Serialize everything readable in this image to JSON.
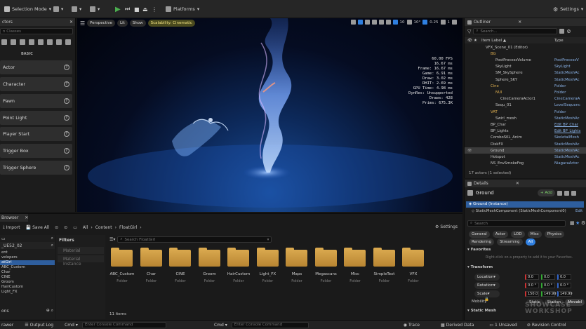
{
  "toolbar": {
    "mode": "Selection Mode",
    "platforms": "Platforms",
    "settings": "Settings"
  },
  "left_panel": {
    "tab": "ctors",
    "search_placeholder": "n Classes",
    "category": "BASIC",
    "items": [
      "Actor",
      "Character",
      "Pawn",
      "Point Light",
      "Player Start",
      "Trigger Box",
      "Trigger Sphere"
    ]
  },
  "viewport": {
    "perspective": "Perspective",
    "lit": "Lit",
    "show": "Show",
    "scalability": "Scalability: Cinematic",
    "grid": "10",
    "angle": "10°",
    "speed": "0.25",
    "cams": "1",
    "stats": {
      "fps": "60.00 FPS",
      "ms": "16.67 ms",
      "frame": "Frame:  16.67 ms",
      "game": "Game:  6.91 ms",
      "draw": "Draw:  3.02 ms",
      "rhit": "RHIT:  2.69 ms",
      "gpu": "GPU Time:  4.98 ms",
      "dynres": "DynRes:  Unsupported",
      "draws": "Draws:  428",
      "prims": "Prims:  675.3K"
    }
  },
  "outliner": {
    "tab": "Outliner",
    "search_placeholder": "Search...",
    "col_label": "Item Label ▲",
    "col_type": "Type",
    "rows": [
      {
        "name": "VFX_Scene_01 (Editor)",
        "type": "",
        "indent": 0
      },
      {
        "name": "BG",
        "type": "",
        "indent": 1,
        "folder": true
      },
      {
        "name": "PostProcessVolume",
        "type": "PostProcessV",
        "indent": 2
      },
      {
        "name": "SkyLight",
        "type": "SkyLight",
        "indent": 2
      },
      {
        "name": "SM_SkySphere",
        "type": "StaticMeshAc",
        "indent": 2
      },
      {
        "name": "Sphere_SKY",
        "type": "StaticMeshAc",
        "indent": 2
      },
      {
        "name": "Cine",
        "type": "Folder",
        "indent": 1,
        "folder": true
      },
      {
        "name": "NUI",
        "type": "Folder",
        "indent": 2,
        "folder": true
      },
      {
        "name": "CineCameraActor1",
        "type": "CineCameraA",
        "indent": 3
      },
      {
        "name": "Sequ_01",
        "type": "LevelSequenc",
        "indent": 2
      },
      {
        "name": "VAT",
        "type": "Folder",
        "indent": 1,
        "folder": true
      },
      {
        "name": "Swirl_mesh",
        "type": "StaticMeshAc",
        "indent": 2
      },
      {
        "name": "BP_Char",
        "type": "Edit BP_Char",
        "indent": 1
      },
      {
        "name": "BP_Lights",
        "type": "Edit BP_Lights",
        "indent": 1
      },
      {
        "name": "ComboSKL_Anim",
        "type": "SkeletalMesh",
        "indent": 1
      },
      {
        "name": "DiskFX",
        "type": "StaticMeshAc",
        "indent": 1
      },
      {
        "name": "Ground",
        "type": "StaticMeshAc",
        "indent": 1,
        "selected": true
      },
      {
        "name": "Hotspot",
        "type": "StaticMeshAc",
        "indent": 1
      },
      {
        "name": "NS_EnvSmokeFog",
        "type": "NiagaraActor",
        "indent": 1
      }
    ],
    "footer": "17 actors (1 selected)"
  },
  "details": {
    "tab": "Details",
    "object": "Ground",
    "add": "+ Add",
    "instance": "Ground (Instance)",
    "component": "StaticMeshComponent (StaticMeshComponent0)",
    "edit": "Edit",
    "search_placeholder": "Search",
    "filters_row1": [
      "General",
      "Actor",
      "LOD",
      "Misc",
      "Physics"
    ],
    "filters_row2": [
      "Rendering",
      "Streaming",
      "All"
    ],
    "favorites": "Favorites",
    "favorites_hint": "Right-click on a property to add it to your Favorites.",
    "transform": "Transform",
    "location": "Location",
    "rotation": "Rotation",
    "scale": "Scale",
    "mobility": "Mobility",
    "loc_vals": [
      "0.0",
      "0.0",
      "0.0"
    ],
    "rot_vals": [
      "0.0 °",
      "0.0 °",
      "0.0 °"
    ],
    "scale_vals": [
      "150.0",
      "149.99",
      "149.99"
    ],
    "mob_opts": [
      "Static",
      "Station",
      "Movabl"
    ],
    "static_mesh": "Static Mesh"
  },
  "browser": {
    "tab": "Browser",
    "import": "Import",
    "save_all": "Save All",
    "crumbs": [
      "All",
      "Content",
      "FloatGirl"
    ],
    "settings": "Settings",
    "search_placeholder": "Search FloatGirl",
    "filters": "Filters",
    "filter_items": [
      "Material",
      "Material Instance"
    ],
    "project": "_UE52_02",
    "tree": [
      "ent",
      "velopers",
      "atGirl",
      "ABC_Custom",
      "Char",
      "CINE",
      "Groom",
      "HairCustom",
      "Light_FX"
    ],
    "tree_bottom": "ons",
    "folders": [
      "ABC_Custom",
      "Char",
      "CINE",
      "Groom",
      "HairCustom",
      "Light_FX",
      "Maps",
      "Megascans",
      "Misc",
      "SimpleText",
      "VFX"
    ],
    "folder_type": "Folder",
    "count": "11 items"
  },
  "status": {
    "drawer": "rawer",
    "output_log": "Output Log",
    "cmd": "Cmd",
    "console_placeholder": "Enter Console Command",
    "trace": "Trace",
    "derived_data": "Derived Data",
    "unsaved": "1 Unsaved",
    "revision": "Revision Control"
  },
  "watermark": "SHOWCASE WORKSHOP"
}
